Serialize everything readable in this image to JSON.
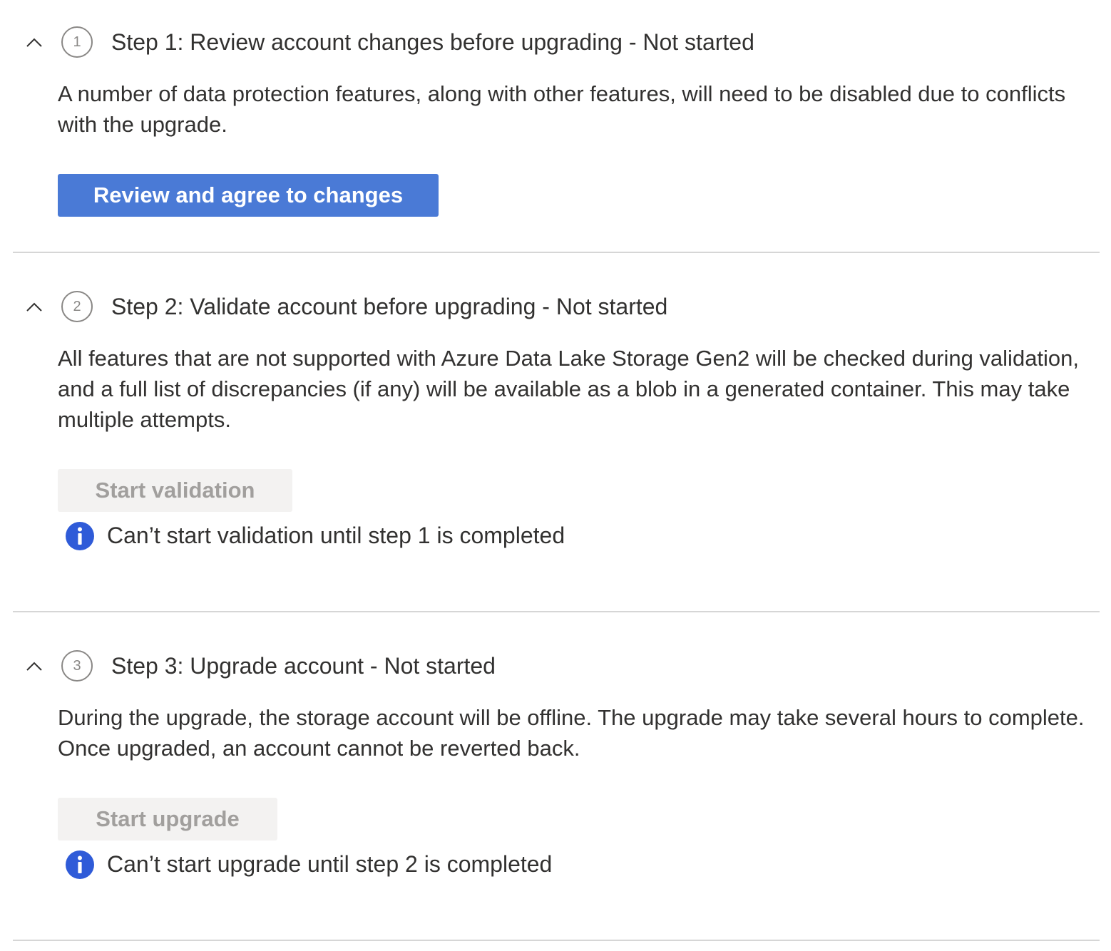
{
  "steps": [
    {
      "number": "1",
      "title": "Step 1: Review account changes before upgrading - Not started",
      "description": "A number of data protection features, along with other features, will need to be disabled due to conflicts with the upgrade.",
      "button_label": "Review and agree to changes"
    },
    {
      "number": "2",
      "title": "Step 2: Validate account before upgrading - Not started",
      "description": "All features that are not supported with Azure Data Lake Storage Gen2 will be checked during validation, and a full list of discrepancies (if any) will be available as a blob in a generated container. This may take multiple attempts.",
      "button_label": "Start validation",
      "info": "Can’t start validation until step 1 is completed"
    },
    {
      "number": "3",
      "title": "Step 3: Upgrade account - Not started",
      "description": "During the upgrade, the storage account will be offline. The upgrade may take several hours to complete. Once upgraded, an account cannot be reverted back.",
      "button_label": "Start upgrade",
      "info": "Can’t start upgrade until step 2 is completed"
    }
  ],
  "colors": {
    "primary_button": "#4a7ad6",
    "info_icon": "#2f5bd8",
    "disabled_button_bg": "#f3f2f1",
    "disabled_button_text": "#a19f9d"
  },
  "icons": {
    "collapse": "chevron-up-icon",
    "info": "info-icon"
  }
}
